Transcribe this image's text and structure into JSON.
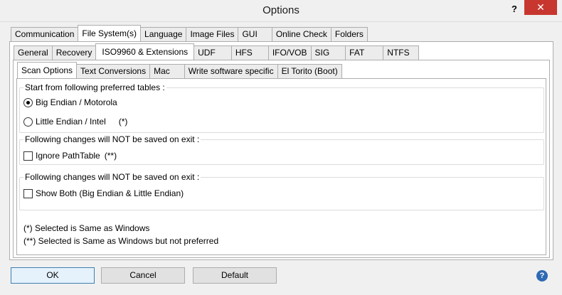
{
  "window": {
    "title": "Options",
    "help_glyph": "?",
    "close_glyph": "✕"
  },
  "tabs_level1": [
    {
      "label": "Communication"
    },
    {
      "label": "File System(s)",
      "active": true
    },
    {
      "label": "Language"
    },
    {
      "label": "Image Files"
    },
    {
      "label": "GUI"
    },
    {
      "label": "Online Check"
    },
    {
      "label": "Folders"
    }
  ],
  "tabs_level2": [
    {
      "label": "General"
    },
    {
      "label": "Recovery"
    },
    {
      "label": "ISO9960 & Extensions",
      "active": true
    },
    {
      "label": "UDF"
    },
    {
      "label": "HFS"
    },
    {
      "label": "IFO/VOB"
    },
    {
      "label": "SIG"
    },
    {
      "label": "FAT"
    },
    {
      "label": "NTFS"
    }
  ],
  "tabs_level3": [
    {
      "label": "Scan Options",
      "active": true
    },
    {
      "label": "Text Conversions"
    },
    {
      "label": "Mac"
    },
    {
      "label": "Write software specific"
    },
    {
      "label": "El Torito (Boot)"
    }
  ],
  "groups": {
    "preferred": {
      "title": "Start from following preferred tables :",
      "big_endian": "Big Endian / Motorola",
      "little_endian": "Little Endian / Intel",
      "little_note": "(*)",
      "selected": "big_endian"
    },
    "pathtable": {
      "title": "Following changes will NOT be saved on exit :",
      "ignore_label": "Ignore PathTable",
      "ignore_note": "(**)",
      "checked": false
    },
    "showboth": {
      "title": "Following changes will NOT be saved on exit :",
      "label": "Show Both (Big Endian & Little Endian)",
      "checked": false
    }
  },
  "footnotes": {
    "single": "(*)  Selected is Same as Windows",
    "double": "(**) Selected is Same as Windows but not preferred"
  },
  "buttons": {
    "ok": "OK",
    "cancel": "Cancel",
    "default": "Default",
    "help_glyph": "?"
  }
}
